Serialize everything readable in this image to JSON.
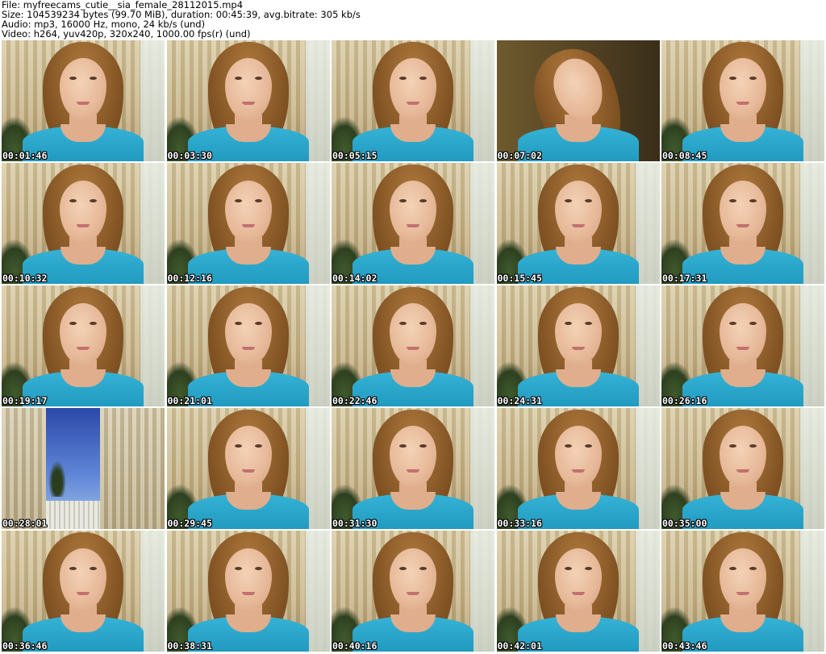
{
  "header": {
    "file": "File: myfreecams_cutie__sia_female_28112015.mp4",
    "size": "Size: 104539234 bytes (99.70 MiB), duration: 00:45:39, avg.bitrate: 305 kb/s",
    "audio": "Audio: mp3, 16000 Hz, mono, 24 kb/s (und)",
    "video": "Video: h264, yuv420p, 320x240, 1000.00 fps(r) (und)"
  },
  "thumbnails": [
    {
      "time": "00:01:46"
    },
    {
      "time": "00:03:30"
    },
    {
      "time": "00:05:15"
    },
    {
      "time": "00:07:02"
    },
    {
      "time": "00:08:45"
    },
    {
      "time": "00:10:32"
    },
    {
      "time": "00:12:16"
    },
    {
      "time": "00:14:02"
    },
    {
      "time": "00:15:45"
    },
    {
      "time": "00:17:31"
    },
    {
      "time": "00:19:17"
    },
    {
      "time": "00:21:01"
    },
    {
      "time": "00:22:46"
    },
    {
      "time": "00:24:31"
    },
    {
      "time": "00:26:16"
    },
    {
      "time": "00:28:01"
    },
    {
      "time": "00:29:45"
    },
    {
      "time": "00:31:30"
    },
    {
      "time": "00:33:16"
    },
    {
      "time": "00:35:00"
    },
    {
      "time": "00:36:46"
    },
    {
      "time": "00:38:31"
    },
    {
      "time": "00:40:16"
    },
    {
      "time": "00:42:01"
    },
    {
      "time": "00:43:46"
    }
  ]
}
